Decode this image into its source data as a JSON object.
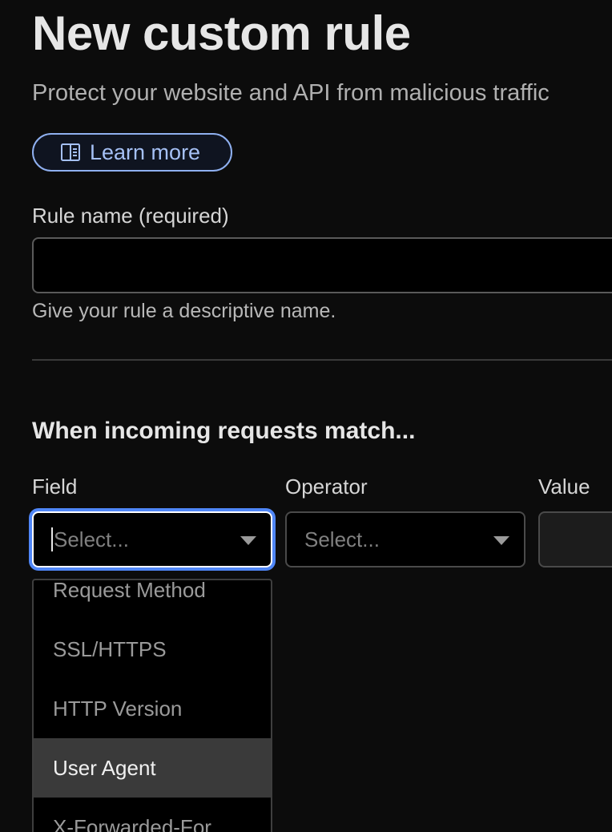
{
  "header": {
    "title": "New custom rule",
    "subtitle": "Protect your website and API from malicious traffic",
    "learn_more": "Learn more"
  },
  "rule_name": {
    "label": "Rule name (required)",
    "value": "",
    "help": "Give your rule a descriptive name."
  },
  "conditions": {
    "heading": "When incoming requests match...",
    "field": {
      "label": "Field",
      "placeholder": "Select..."
    },
    "operator": {
      "label": "Operator",
      "placeholder": "Select..."
    },
    "value": {
      "label": "Value"
    }
  },
  "field_dropdown": {
    "options": [
      "Request Method",
      "SSL/HTTPS",
      "HTTP Version",
      "User Agent",
      "X-Forwarded-For"
    ],
    "highlighted": "User Agent"
  },
  "colors": {
    "background": "#0c0c0c",
    "accent": "#4f86f7",
    "link": "#a5c0f5",
    "highlight_row": "#3a3a3a"
  }
}
